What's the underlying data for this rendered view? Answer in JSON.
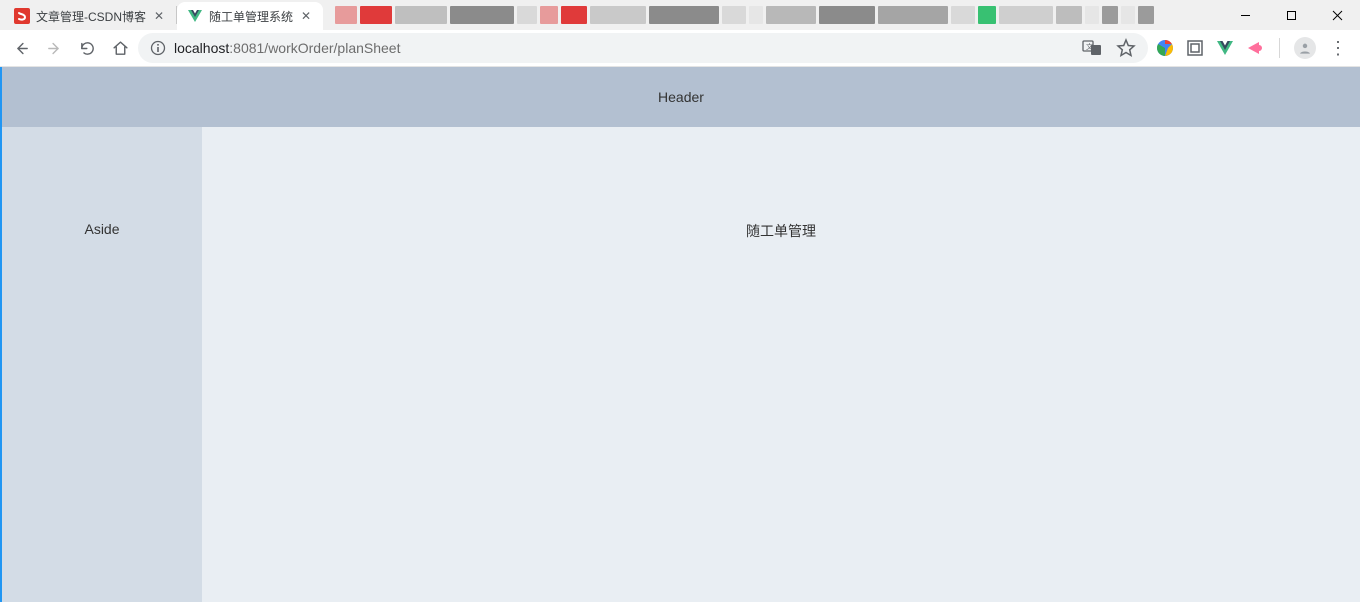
{
  "browser": {
    "tabs": [
      {
        "title": "文章管理-CSDN博客",
        "active": false
      },
      {
        "title": "随工单管理系统",
        "active": true
      }
    ],
    "url_host": "localhost",
    "url_port_path": ":8081/workOrder/planSheet"
  },
  "page": {
    "header": "Header",
    "aside": "Aside",
    "main": "随工单管理"
  },
  "colors": {
    "header_bg": "#b3c0d1",
    "aside_bg": "#d3dce6",
    "main_bg": "#e9eef3",
    "accent_left_border": "#2196f3"
  }
}
